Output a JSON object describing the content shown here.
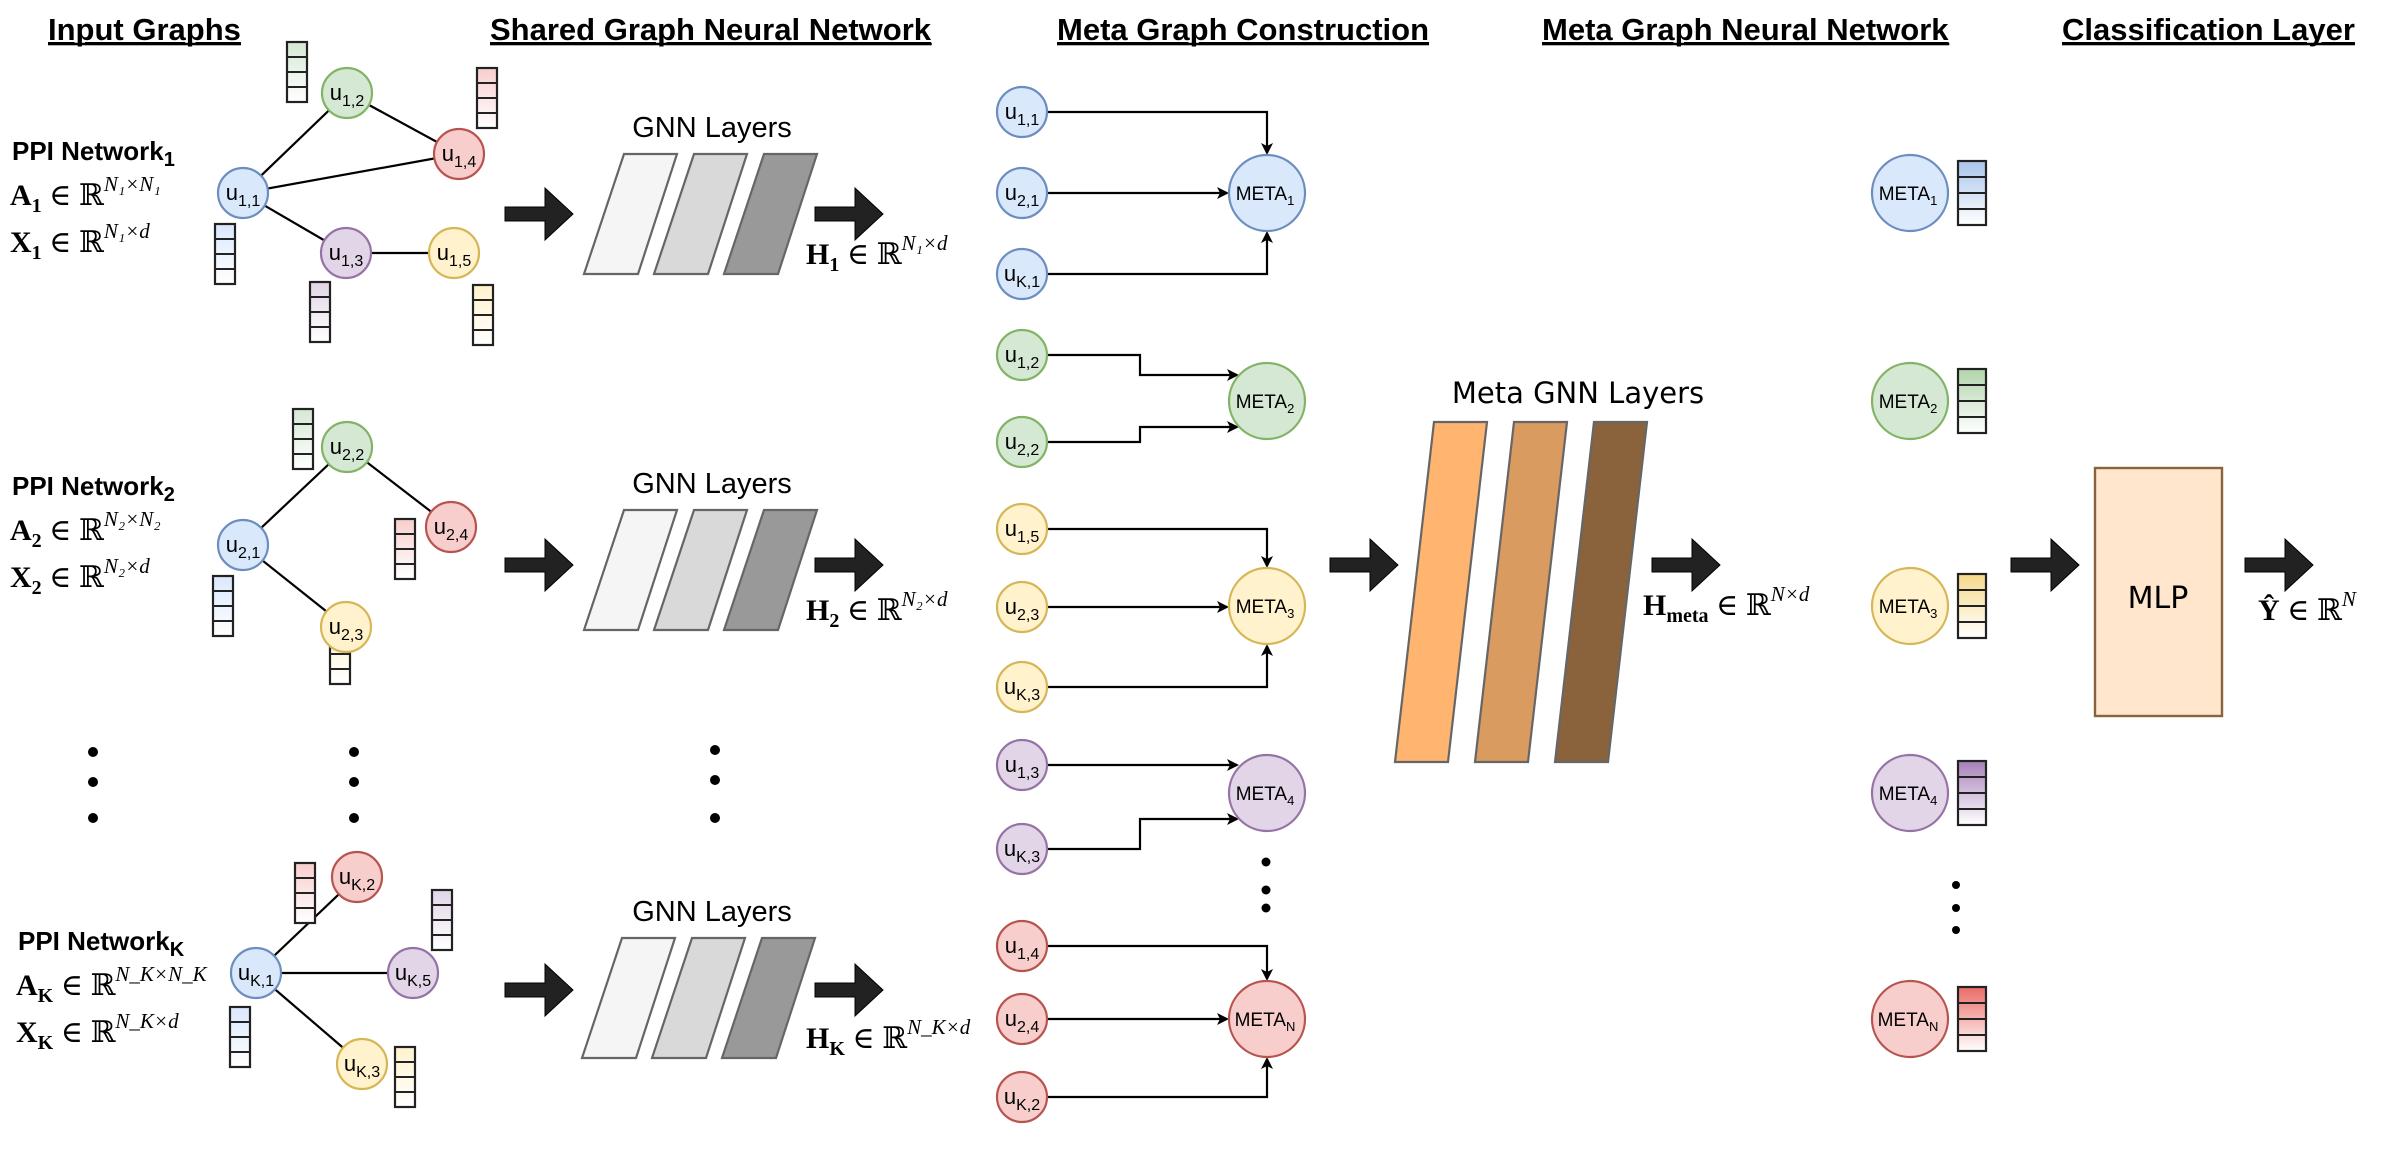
{
  "headings": [
    "Input Graphs",
    "Shared Graph Neural Network",
    "Meta Graph Construction",
    "Meta Graph Neural Network",
    "Classification Layer"
  ],
  "colors": {
    "blue": {
      "fill": "#dae8fc",
      "stroke": "#6c8ebf",
      "bar_top": "#a9c4eb"
    },
    "green": {
      "fill": "#d5e8d4",
      "stroke": "#82b366",
      "bar_top": "#b1d4aa"
    },
    "red": {
      "fill": "#f8cecc",
      "stroke": "#b85450",
      "bar_top": "#ea6b66"
    },
    "purple": {
      "fill": "#e1d5e7",
      "stroke": "#9673a6",
      "bar_top": "#a680b8"
    },
    "yellow": {
      "fill": "#fff2cc",
      "stroke": "#d6b656",
      "bar_top": "#f5d98a"
    },
    "gnn_layers": [
      "#f5f5f5",
      "#d9d9d9",
      "#999999"
    ],
    "meta_layers": [
      "#ffb570",
      "#d99b5f",
      "#8a633c"
    ],
    "mlp_fill": "#ffe6cc",
    "mlp_stroke": "#8a633c",
    "arrow": "#222222"
  },
  "input_graphs": [
    {
      "title": "PPI Network",
      "title_sub": "1",
      "adj": {
        "sym": "A",
        "sub": "1",
        "sup": "N₁×N₁"
      },
      "feat": {
        "sym": "X",
        "sub": "1",
        "sup": "N₁×d"
      },
      "nodes": [
        {
          "id": "u11",
          "base": "u",
          "sub": "1,1",
          "color": "blue"
        },
        {
          "id": "u12",
          "base": "u",
          "sub": "1,2",
          "color": "green"
        },
        {
          "id": "u14",
          "base": "u",
          "sub": "1,4",
          "color": "red"
        },
        {
          "id": "u13",
          "base": "u",
          "sub": "1,3",
          "color": "purple"
        },
        {
          "id": "u15",
          "base": "u",
          "sub": "1,5",
          "color": "yellow"
        }
      ],
      "edges": [
        [
          "u11",
          "u12"
        ],
        [
          "u12",
          "u14"
        ],
        [
          "u11",
          "u14"
        ],
        [
          "u11",
          "u13"
        ],
        [
          "u13",
          "u15"
        ]
      ]
    },
    {
      "title": "PPI Network",
      "title_sub": "2",
      "adj": {
        "sym": "A",
        "sub": "2",
        "sup": "N₂×N₂"
      },
      "feat": {
        "sym": "X",
        "sub": "2",
        "sup": "N₂×d"
      },
      "nodes": [
        {
          "id": "u21",
          "base": "u",
          "sub": "2,1",
          "color": "blue"
        },
        {
          "id": "u22",
          "base": "u",
          "sub": "2,2",
          "color": "green"
        },
        {
          "id": "u24",
          "base": "u",
          "sub": "2,4",
          "color": "red"
        },
        {
          "id": "u23",
          "base": "u",
          "sub": "2,3",
          "color": "yellow"
        }
      ],
      "edges": [
        [
          "u21",
          "u22"
        ],
        [
          "u22",
          "u24"
        ],
        [
          "u21",
          "u23"
        ]
      ]
    },
    {
      "title": "PPI Network",
      "title_sub": "K",
      "adj": {
        "sym": "A",
        "sub": "K",
        "sup": "N_K×N_K"
      },
      "feat": {
        "sym": "X",
        "sub": "K",
        "sup": "N_K×d"
      },
      "nodes": [
        {
          "id": "uK1",
          "base": "u",
          "sub": "K,1",
          "color": "blue"
        },
        {
          "id": "uK2",
          "base": "u",
          "sub": "K,2",
          "color": "red"
        },
        {
          "id": "uK5",
          "base": "u",
          "sub": "K,5",
          "color": "purple"
        },
        {
          "id": "uK3",
          "base": "u",
          "sub": "K,3",
          "color": "yellow"
        }
      ],
      "edges": [
        [
          "uK1",
          "uK2"
        ],
        [
          "uK1",
          "uK5"
        ],
        [
          "uK1",
          "uK3"
        ]
      ]
    }
  ],
  "gnn": {
    "layer_title": "GNN Layers",
    "outputs": [
      {
        "sym": "H",
        "sub": "1",
        "sup": "N₁×d"
      },
      {
        "sym": "H",
        "sub": "2",
        "sup": "N₂×d"
      },
      {
        "sym": "H",
        "sub": "K",
        "sup": "N_K×d"
      }
    ]
  },
  "meta_construction": {
    "groups": [
      {
        "meta": {
          "base": "META",
          "sub": "1"
        },
        "color": "blue",
        "inputs": [
          "1,1",
          "2,1",
          "K,1"
        ]
      },
      {
        "meta": {
          "base": "META",
          "sub": "2"
        },
        "color": "green",
        "inputs": [
          "1,2",
          "2,2"
        ]
      },
      {
        "meta": {
          "base": "META",
          "sub": "3"
        },
        "color": "yellow",
        "inputs": [
          "1,5",
          "2,3",
          "K,3"
        ]
      },
      {
        "meta": {
          "base": "META",
          "sub": "4"
        },
        "color": "purple",
        "inputs": [
          "1,3",
          "K,3"
        ]
      },
      {
        "meta": {
          "base": "META",
          "sub": "N"
        },
        "color": "red",
        "inputs": [
          "1,4",
          "2,4",
          "K,2"
        ]
      }
    ]
  },
  "meta_gnn": {
    "layer_title": "Meta GNN Layers",
    "output": {
      "sym": "H",
      "sub": "meta",
      "sup": "N×d"
    }
  },
  "meta_embeddings": [
    {
      "base": "META",
      "sub": "1",
      "color": "blue"
    },
    {
      "base": "META",
      "sub": "2",
      "color": "green"
    },
    {
      "base": "META",
      "sub": "3",
      "color": "yellow"
    },
    {
      "base": "META",
      "sub": "4",
      "color": "purple"
    },
    {
      "base": "META",
      "sub": "N",
      "color": "red"
    }
  ],
  "classification": {
    "mlp_label": "MLP",
    "output": {
      "sym": "Ŷ",
      "sup": "N"
    }
  },
  "symbols": {
    "in": "∈",
    "reals": "ℝ"
  }
}
